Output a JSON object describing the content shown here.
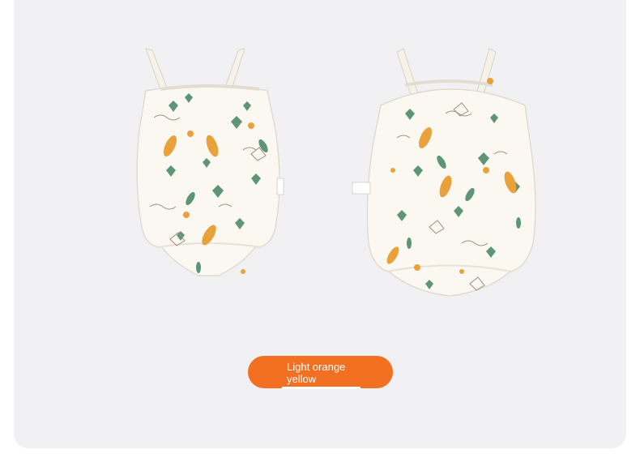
{
  "product": {
    "color_option": "Light orange yellow"
  },
  "colors": {
    "background": "#f1f0f2",
    "pill": "#f36f21",
    "fabric": "#fbf8f1",
    "leaf_green": "#5e9577",
    "leaf_orange": "#e9a23b"
  }
}
